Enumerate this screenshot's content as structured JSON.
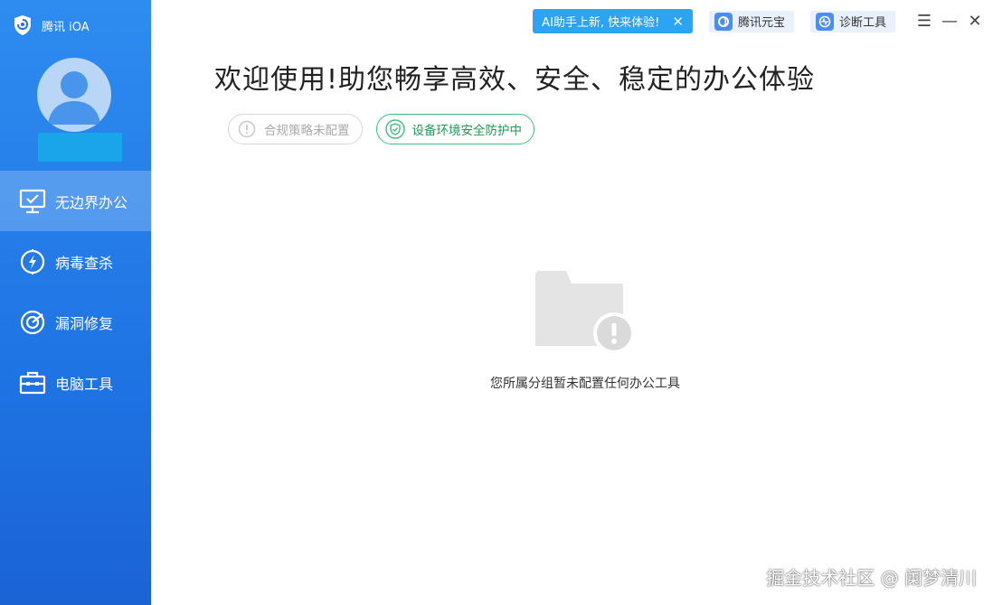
{
  "app": {
    "name": "腾讯 iOA"
  },
  "topbar": {
    "ai_banner": "AI助手上新, 快来体验!",
    "close_glyph": "✕",
    "tools": [
      {
        "label": "腾讯元宝",
        "icon": "yuanbao-icon"
      },
      {
        "label": "诊断工具",
        "icon": "diagnose-icon"
      }
    ],
    "window_controls": {
      "menu": "☰",
      "minimize": "—",
      "close": "✕"
    }
  },
  "sidebar": {
    "nav": [
      {
        "label": "无边界办公",
        "icon": "monitor-icon",
        "active": true
      },
      {
        "label": "病毒查杀",
        "icon": "virus-scan-icon",
        "active": false
      },
      {
        "label": "漏洞修复",
        "icon": "vulnerability-fix-icon",
        "active": false
      },
      {
        "label": "电脑工具",
        "icon": "toolbox-icon",
        "active": false
      }
    ]
  },
  "main": {
    "welcome": "欢迎使用!助您畅享高效、安全、稳定的办公体验",
    "status": {
      "policy": "合规策略未配置",
      "protection": "设备环境安全防护中"
    },
    "empty_message": "您所属分组暂未配置任何办公工具"
  },
  "watermark": "掘金技术社区 @ 阑梦清川",
  "colors": {
    "sidebar": "#1f74e4",
    "ai_banner": "#2ba4f3",
    "protection_green": "#3cc07a"
  }
}
